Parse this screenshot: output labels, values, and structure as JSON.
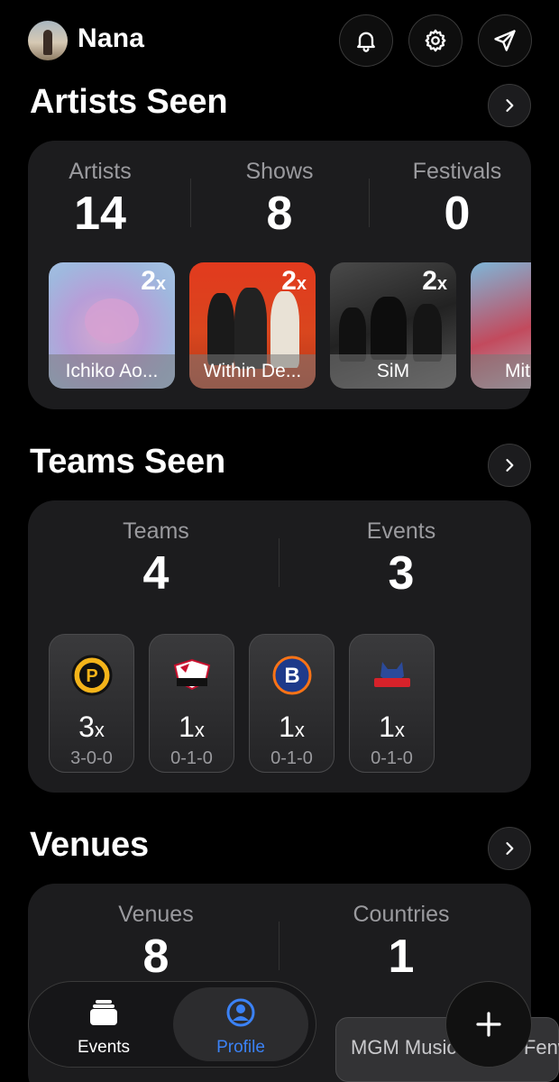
{
  "header": {
    "username": "Nana",
    "avatar_icon": "profile-photo"
  },
  "artists_section": {
    "title": "Artists Seen",
    "stats": [
      {
        "label": "Artists",
        "value": "14"
      },
      {
        "label": "Shows",
        "value": "8"
      },
      {
        "label": "Festivals",
        "value": "0"
      }
    ],
    "artists": [
      {
        "name": "Ichiko Ao...",
        "count": "2",
        "suffix": "x"
      },
      {
        "name": "Within De...",
        "count": "2",
        "suffix": "x"
      },
      {
        "name": "SiM",
        "count": "2",
        "suffix": "x"
      },
      {
        "name": "Mit",
        "count": "",
        "suffix": ""
      }
    ]
  },
  "teams_section": {
    "title": "Teams Seen",
    "stats": [
      {
        "label": "Teams",
        "value": "4"
      },
      {
        "label": "Events",
        "value": "3"
      }
    ],
    "teams": [
      {
        "logo": "providence-bruins-logo",
        "count": "3",
        "suffix": "x",
        "record": "3-0-0"
      },
      {
        "logo": "charlotte-checkers-logo",
        "count": "1",
        "suffix": "x",
        "record": "0-1-0"
      },
      {
        "logo": "bridgeport-islanders-logo",
        "count": "1",
        "suffix": "x",
        "record": "0-1-0"
      },
      {
        "logo": "hartford-wolf-pack-logo",
        "count": "1",
        "suffix": "x",
        "record": "0-1-0"
      }
    ]
  },
  "venues_section": {
    "title": "Venues",
    "stats": [
      {
        "label": "Venues",
        "value": "8"
      },
      {
        "label": "Countries",
        "value": "1"
      }
    ],
    "venue_preview": "MGM Music Hall at Fenwa"
  },
  "tabbar": {
    "tabs": [
      {
        "label": "Events",
        "icon": "stack-icon",
        "active": false
      },
      {
        "label": "Profile",
        "icon": "person-circle-icon",
        "active": true
      }
    ],
    "accent": "#3b82f6"
  }
}
